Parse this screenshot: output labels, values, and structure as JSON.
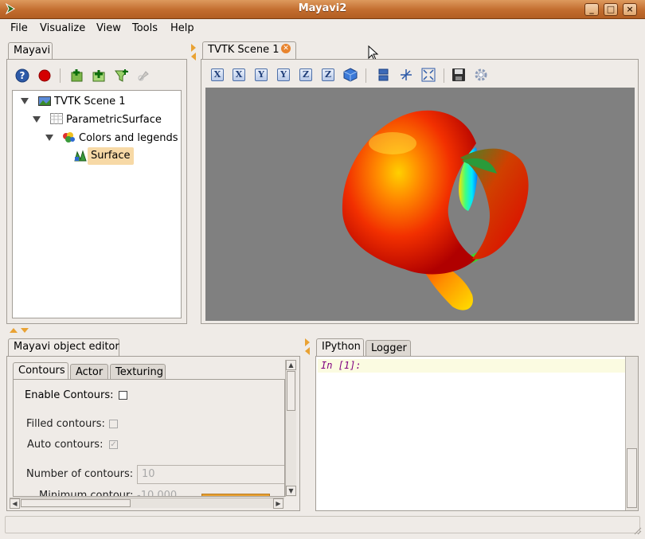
{
  "window": {
    "title": "Mayavi2"
  },
  "menu": [
    "File",
    "Visualize",
    "View",
    "Tools",
    "Help"
  ],
  "mayavi_panel": {
    "tab_label": "Mayavi",
    "tree": {
      "scene": "TVTK Scene 1",
      "source": "ParametricSurface",
      "module_manager": "Colors and legends",
      "module": "Surface"
    }
  },
  "scene_panel": {
    "tab_label": "TVTK Scene 1",
    "toolbar_axes": [
      "X",
      "X",
      "Y",
      "Y",
      "Z",
      "Z"
    ],
    "background_color": "#808080"
  },
  "object_editor": {
    "tab_label": "Mayavi object editor",
    "subtabs": [
      "Contours",
      "Actor",
      "Texturing"
    ],
    "enable_contours_label": "Enable Contours:",
    "filled_contours_label": "Filled contours:",
    "auto_contours_label": "Auto contours:",
    "number_of_contours_label": "Number of contours:",
    "number_of_contours_value": "10",
    "minimum_contour_label": "Minimum contour:",
    "minimum_contour_value": "-10.000",
    "enable_contours": false,
    "filled_contours": false,
    "auto_contours": true
  },
  "shell_panel": {
    "tabs": [
      "IPython",
      "Logger"
    ],
    "prompt": "In [1]:"
  },
  "colors": {
    "title_bar": "#c26c2e",
    "accent": "#e9a233",
    "selection": "#f7d9a6"
  }
}
